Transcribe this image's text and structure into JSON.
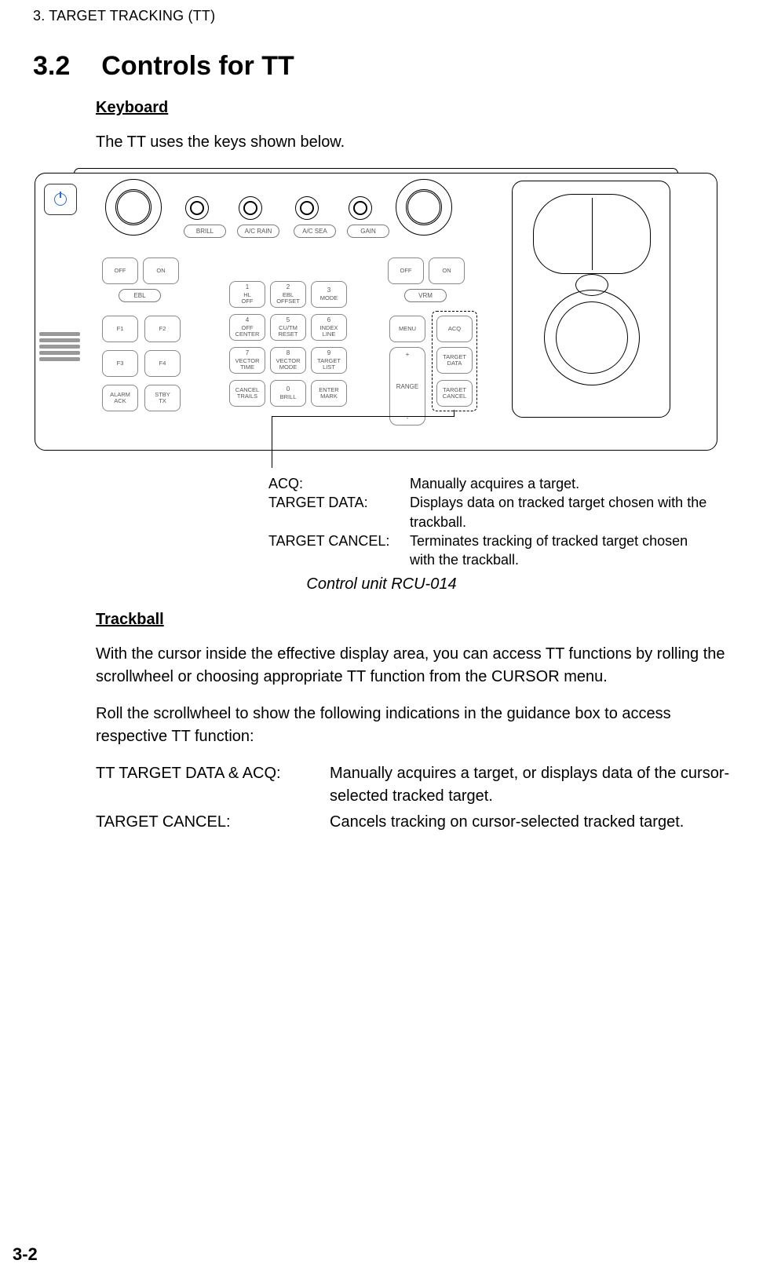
{
  "running_head": "3. TARGET TRACKING (TT)",
  "section": {
    "num": "3.2",
    "title": "Controls for TT"
  },
  "sub_keyboard": "Keyboard",
  "intro_keyboard": "The TT uses the keys shown below.",
  "panel": {
    "knobs": {
      "brill": "BRILL",
      "ac_rain": "A/C RAIN",
      "ac_sea": "A/C SEA",
      "gain": "GAIN"
    },
    "ebl": {
      "off": "OFF",
      "on": "ON",
      "label": "EBL"
    },
    "vrm": {
      "off": "OFF",
      "on": "ON",
      "label": "VRM"
    },
    "fkeys": {
      "f1": "F1",
      "f2": "F2",
      "f3": "F3",
      "f4": "F4",
      "alarm_ack_l1": "ALARM",
      "alarm_ack_l2": "ACK",
      "stby_tx_l1": "STBY",
      "stby_tx_l2": "TX"
    },
    "numpad": {
      "k1_n": "1",
      "k1_l1": "HL",
      "k1_l2": "OFF",
      "k2_n": "2",
      "k2_l1": "EBL",
      "k2_l2": "OFFSET",
      "k3_n": "3",
      "k3_l1": "MODE",
      "k4_n": "4",
      "k4_l1": "OFF",
      "k4_l2": "CENTER",
      "k5_n": "5",
      "k5_l1": "CU/TM",
      "k5_l2": "RESET",
      "k6_n": "6",
      "k6_l1": "INDEX",
      "k6_l2": "LINE",
      "k7_n": "7",
      "k7_l1": "VECTOR",
      "k7_l2": "TIME",
      "k8_n": "8",
      "k8_l1": "VECTOR",
      "k8_l2": "MODE",
      "k9_n": "9",
      "k9_l1": "TARGET",
      "k9_l2": "LIST",
      "cancel_l1": "CANCEL",
      "cancel_l2": "TRAILS",
      "k0_n": "0",
      "k0_l1": "BRILL",
      "enter_l1": "ENTER",
      "enter_l2": "MARK"
    },
    "right": {
      "menu": "MENU",
      "acq": "ACQ",
      "range_plus": "+",
      "range_label": "RANGE",
      "range_minus": "-",
      "target_data_l1": "TARGET",
      "target_data_l2": "DATA",
      "target_cancel_l1": "TARGET",
      "target_cancel_l2": "CANCEL"
    }
  },
  "callout": {
    "acq_label": "ACQ:",
    "acq_text": "Manually acquires a target.",
    "td_label": "TARGET DATA:",
    "td_text": "Displays data on tracked target chosen with the trackball.",
    "tc_label": "TARGET CANCEL:",
    "tc_text": "Terminates tracking of tracked target chosen with the trackball."
  },
  "figure_caption": "Control unit RCU-014",
  "sub_trackball": "Trackball",
  "trackball_p1": "With the cursor inside the effective display area, you can access TT functions by rolling the scrollwheel or choosing appropriate TT function from the CURSOR menu.",
  "trackball_p2": "Roll the scrollwheel to show the following indications in the guidance box to access respective TT function:",
  "defs": {
    "d1_label": "TT TARGET DATA & ACQ:",
    "d1_text": "Manually acquires a target, or displays data of the cursor-selected tracked target.",
    "d2_label": "TARGET CANCEL:",
    "d2_text": "Cancels tracking on cursor-selected tracked target."
  },
  "page_number": "3-2"
}
